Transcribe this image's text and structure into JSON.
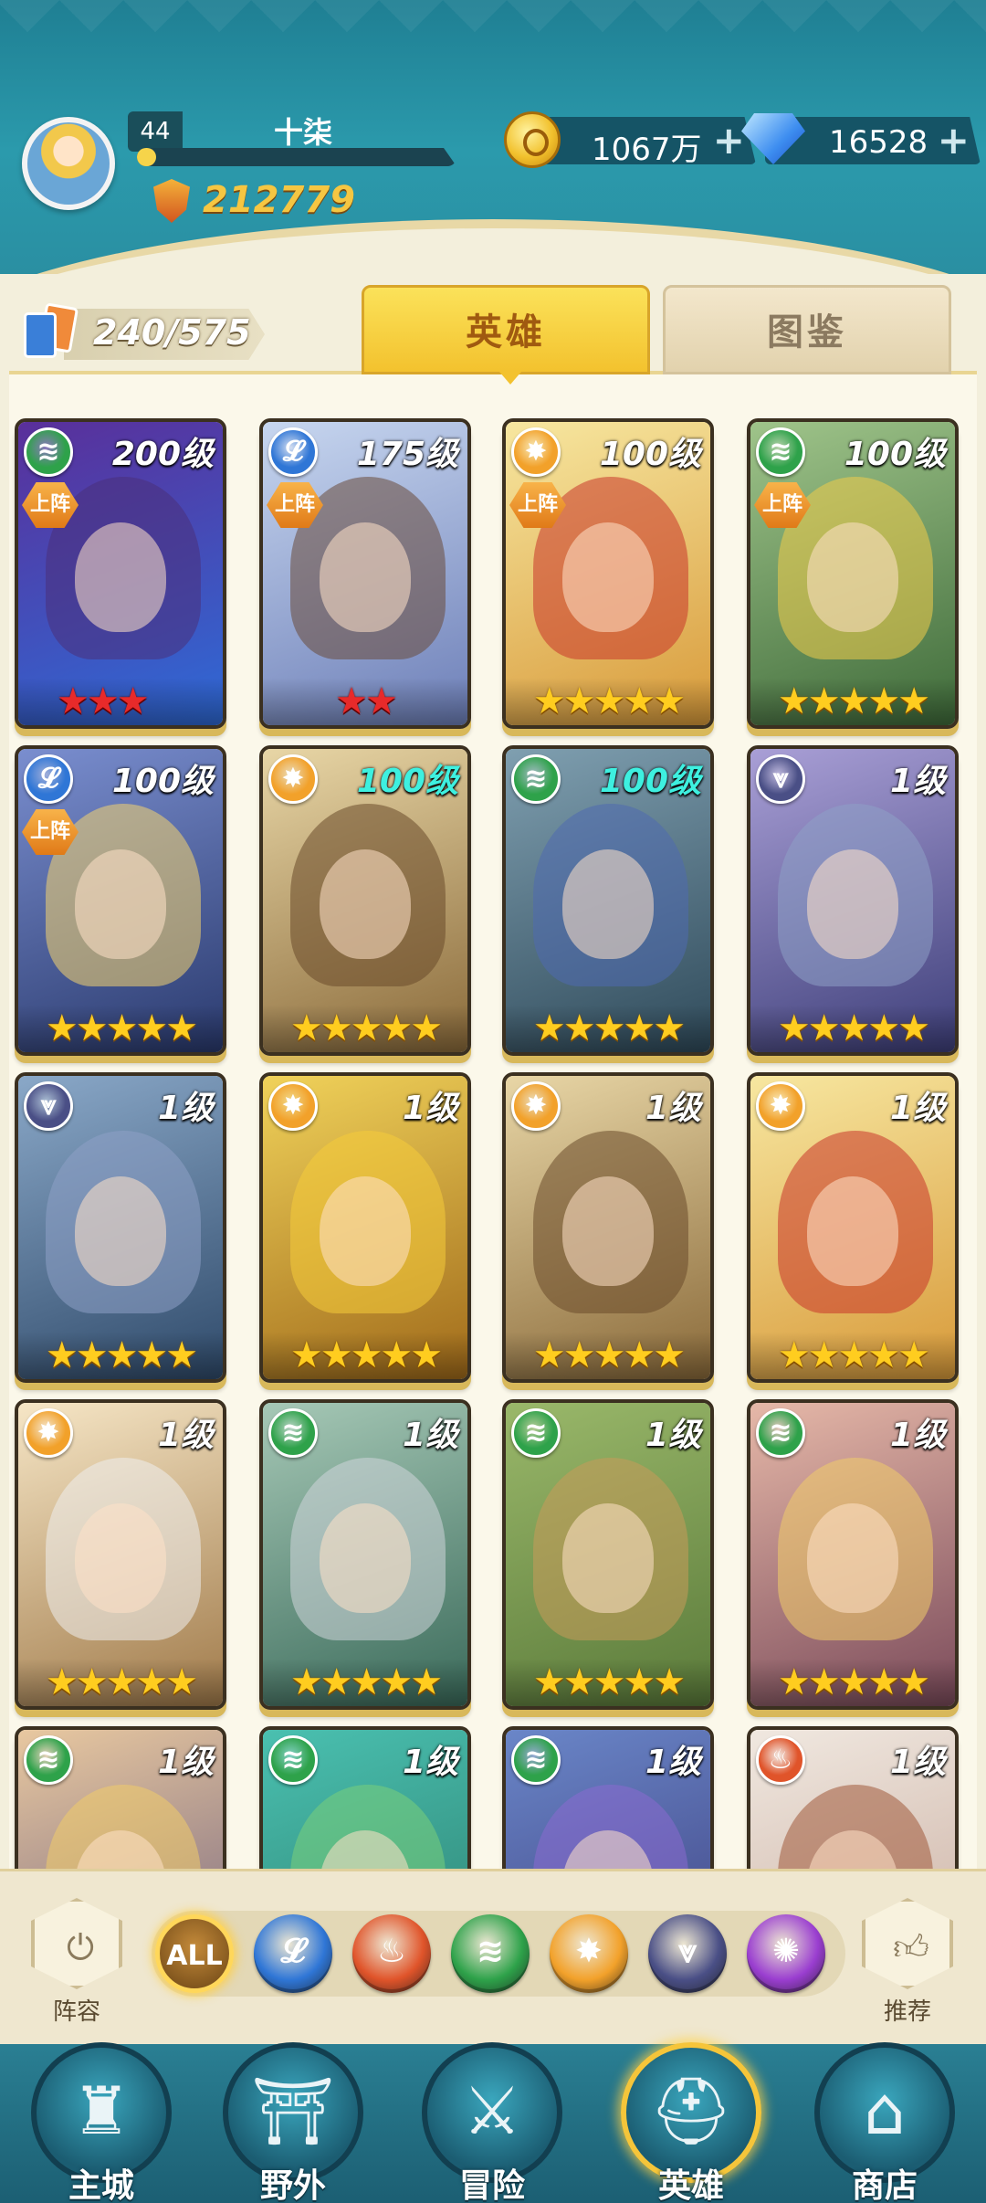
{
  "player": {
    "level": "44",
    "name": "十柒",
    "xp_progress": 0.06,
    "power": "212779"
  },
  "currencies": {
    "gold": "1067万",
    "gems": "16528",
    "plus_icon": "+"
  },
  "collection": {
    "count": "240/575"
  },
  "tabs": {
    "heroes": "英雄",
    "codex": "图鉴"
  },
  "factions": {
    "all": {
      "label": "ALL",
      "color": "#7a5020"
    },
    "water": {
      "icon": "wave-icon",
      "color": "#2f76d6",
      "glyph": "𝓛"
    },
    "fire": {
      "icon": "flame-icon",
      "color": "#e0542a",
      "glyph": "♨"
    },
    "wind": {
      "icon": "wind-icon",
      "color": "#2ea24a",
      "glyph": "≋"
    },
    "light": {
      "icon": "sun-icon",
      "color": "#f2a12a",
      "glyph": "✸"
    },
    "dark": {
      "icon": "rune-icon",
      "color": "#4a4f86",
      "glyph": "⩔"
    },
    "void": {
      "icon": "spiral-icon",
      "color": "#9a3ed0",
      "glyph": "✺"
    }
  },
  "heroes": [
    {
      "level": "200级",
      "faction": "wind",
      "deployed": "上阵",
      "stars": 3,
      "star_color": "red",
      "art": [
        "#5a2f9a",
        "#2e6ad6"
      ],
      "hair": "#4a2f7a"
    },
    {
      "level": "175级",
      "faction": "water",
      "deployed": "上阵",
      "stars": 2,
      "star_color": "red",
      "art": [
        "#c7d6ef",
        "#6d7fb8"
      ],
      "hair": "#6a4a3a"
    },
    {
      "level": "100级",
      "faction": "light",
      "deployed": "上阵",
      "stars": 5,
      "star_color": "gold",
      "art": [
        "#f7e7a0",
        "#d89a3a"
      ],
      "hair": "#c8352a"
    },
    {
      "level": "100级",
      "faction": "wind",
      "deployed": "上阵",
      "stars": 5,
      "star_color": "gold",
      "art": [
        "#9fc48a",
        "#3f6b3a"
      ],
      "hair": "#f1cc4a"
    },
    {
      "level": "100级",
      "faction": "water",
      "deployed": "上阵",
      "stars": 5,
      "star_color": "gold",
      "art": [
        "#7a8ecf",
        "#2a3a6e"
      ],
      "hair": "#f4d470"
    },
    {
      "level": "100级",
      "faction": "light",
      "deployed": "",
      "stars": 5,
      "star_color": "gold",
      "art": [
        "#e8d6a6",
        "#8a6a3a"
      ],
      "hair": "#6a4a2a",
      "level_color": "cyan"
    },
    {
      "level": "100级",
      "faction": "wind",
      "deployed": "",
      "stars": 5,
      "star_color": "gold",
      "art": [
        "#7f9fb0",
        "#2f4a5a"
      ],
      "hair": "#4f6ab0",
      "level_color": "cyan"
    },
    {
      "level": "1级",
      "faction": "dark",
      "deployed": "",
      "stars": 5,
      "star_color": "gold",
      "art": [
        "#a99fd6",
        "#3e3f7a"
      ],
      "hair": "#8ea0c6"
    },
    {
      "level": "1级",
      "faction": "dark",
      "deployed": "",
      "stars": 5,
      "star_color": "gold",
      "art": [
        "#8aa8c8",
        "#2f4a6a"
      ],
      "hair": "#8ea0c6"
    },
    {
      "level": "1级",
      "faction": "light",
      "deployed": "",
      "stars": 5,
      "star_color": "gold",
      "art": [
        "#f0d25a",
        "#a06a1a"
      ],
      "hair": "#f5cc3a"
    },
    {
      "level": "1级",
      "faction": "light",
      "deployed": "",
      "stars": 5,
      "star_color": "gold",
      "art": [
        "#e8d6a6",
        "#8a6a3a"
      ],
      "hair": "#6a4a2a"
    },
    {
      "level": "1级",
      "faction": "light",
      "deployed": "",
      "stars": 5,
      "star_color": "gold",
      "art": [
        "#f7e7a0",
        "#d89a3a"
      ],
      "hair": "#c8352a"
    },
    {
      "level": "1级",
      "faction": "light",
      "deployed": "",
      "stars": 5,
      "star_color": "gold",
      "art": [
        "#f6e6c6",
        "#a07a4a"
      ],
      "hair": "#eeeeee"
    },
    {
      "level": "1级",
      "faction": "wind",
      "deployed": "",
      "stars": 5,
      "star_color": "gold",
      "art": [
        "#a6c8b6",
        "#3a6a5a"
      ],
      "hair": "#cfd6da"
    },
    {
      "level": "1级",
      "faction": "wind",
      "deployed": "",
      "stars": 5,
      "star_color": "gold",
      "art": [
        "#9ab86a",
        "#5a7a3a"
      ],
      "hair": "#c89a5a"
    },
    {
      "level": "1级",
      "faction": "wind",
      "deployed": "",
      "stars": 5,
      "star_color": "gold",
      "art": [
        "#e6b8a8",
        "#7a4a5a"
      ],
      "hair": "#f1cc6a"
    },
    {
      "level": "1级",
      "faction": "wind",
      "deployed": "",
      "stars": 0,
      "star_color": "gold",
      "art": [
        "#e8c8a0",
        "#6a5a7a"
      ],
      "hair": "#f1cc6a"
    },
    {
      "level": "1级",
      "faction": "wind",
      "deployed": "",
      "stars": 0,
      "star_color": "gold",
      "art": [
        "#4ac0b0",
        "#2a7a6a"
      ],
      "hair": "#7ad07a"
    },
    {
      "level": "1级",
      "faction": "wind",
      "deployed": "",
      "stars": 0,
      "star_color": "gold",
      "art": [
        "#6a86c8",
        "#3a3a7a"
      ],
      "hair": "#8a6ad0"
    },
    {
      "level": "1级",
      "faction": "fire",
      "deployed": "",
      "stars": 0,
      "star_color": "gold",
      "art": [
        "#f0e8e0",
        "#c6a89a"
      ],
      "hair": "#a05a3a"
    }
  ],
  "filter_bar": {
    "lineup_label": "阵容",
    "recommend_label": "推荐",
    "all_label": "ALL"
  },
  "nav": [
    {
      "key": "city",
      "label": "主城",
      "icon": "castle-icon",
      "glyph": "♜"
    },
    {
      "key": "wild",
      "label": "野外",
      "icon": "portal-icon",
      "glyph": "⛩"
    },
    {
      "key": "adventure",
      "label": "冒险",
      "icon": "sword-icon",
      "glyph": "⚔"
    },
    {
      "key": "heroes",
      "label": "英雄",
      "icon": "helmet-icon",
      "glyph": "⛑",
      "active": true
    },
    {
      "key": "shop",
      "label": "商店",
      "icon": "shop-icon",
      "glyph": "⌂"
    }
  ]
}
